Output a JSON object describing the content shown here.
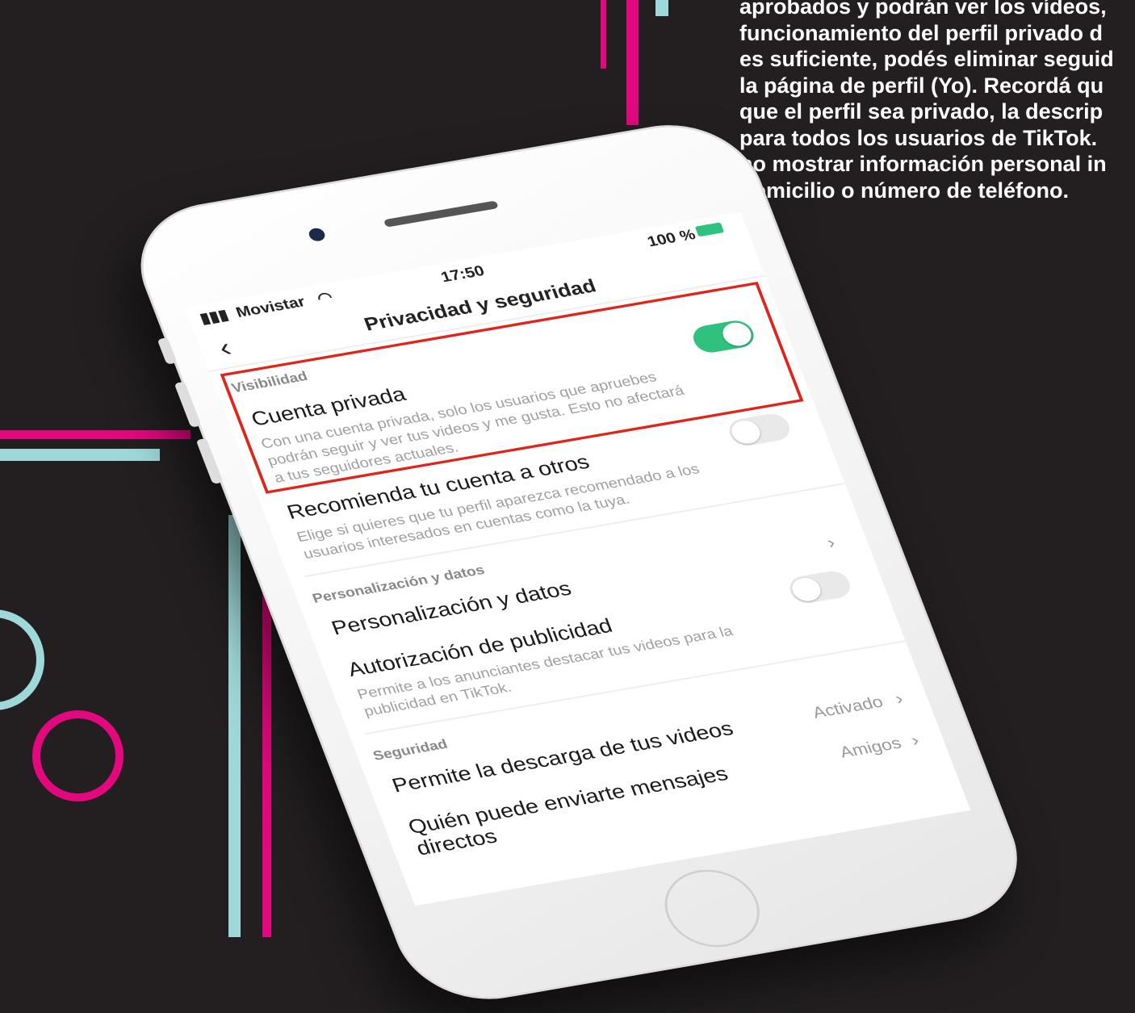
{
  "overlay_text": {
    "lines": [
      "aprobados y podrán ver los vídeos,",
      "funcionamiento del perfil privado d",
      "es suficiente, podés eliminar seguid",
      "la página de perfil (Yo). Recordá qu",
      "que el perfil sea privado, la descrip",
      "para todos los usuarios de TikTok.",
      "no mostrar información personal in",
      " domicilio o número de teléfono."
    ]
  },
  "colors": {
    "background": "#231f20",
    "accent_pink": "#e3087e",
    "accent_teal": "#9ed8d8",
    "toggle_on": "#2ec27e",
    "toggle_off": "#e9e9e9",
    "highlight": "#e2231a"
  },
  "status_bar": {
    "carrier": "Movistar",
    "time": "17:50",
    "battery": "100 %"
  },
  "nav": {
    "back_icon": "chevron-left-icon",
    "title": "Privacidad y seguridad"
  },
  "visibility": {
    "section_label": "Visibilidad",
    "private_account": {
      "title": "Cuenta privada",
      "description_lines": [
        "Con una cuenta privada, solo los usuarios que apruebes",
        "podrán seguir y ver tus videos y me gusta. Esto no afectará",
        "a tus seguidores actuales."
      ],
      "enabled": true
    },
    "recommend": {
      "title": "Recomienda tu cuenta a otros",
      "description_lines": [
        "Elige si quieres que tu perfil aparezca recomendado a los",
        "usuarios interesados en cuentas como la tuya."
      ],
      "enabled": false
    }
  },
  "personalization": {
    "section_label": "Personalización y datos",
    "item_title": "Personalización y datos",
    "ads": {
      "title": "Autorización de publicidad",
      "description_lines": [
        "Permite a los anunciantes destacar tus videos para la",
        "publicidad en TikTok."
      ],
      "enabled": false
    }
  },
  "security": {
    "section_label": "Seguridad",
    "download": {
      "title": "Permite la descarga de tus videos",
      "value": "Activado"
    },
    "messages": {
      "title_lines": [
        "Quién puede enviarte mensajes",
        "directos"
      ],
      "value": "Amigos"
    }
  }
}
